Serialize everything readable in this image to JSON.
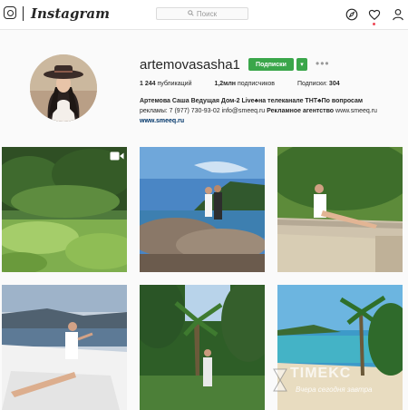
{
  "header": {
    "wordmark": "Instagram",
    "search_placeholder": "Поиск"
  },
  "colors": {
    "follow_green": "#3aa64a",
    "link_blue": "#003569",
    "notification_red": "#ed4956"
  },
  "icons": [
    "instagram-icon",
    "search-icon",
    "compass-icon",
    "heart-icon",
    "person-icon",
    "more-icon",
    "video-icon"
  ],
  "profile": {
    "username": "artemovasasha1",
    "follow_label": "Подписки",
    "dropdown_label": "▾",
    "more_label": "•••",
    "stats": {
      "posts_count": "1 244",
      "posts_label": "публикаций",
      "followers_count": "1,2млн",
      "followers_label": "подписчиков",
      "following_label": "Подписки:",
      "following_count": "304"
    },
    "bio": {
      "line1_bold": "Артемова Саша Ведущая Дом-2 Live♣на телеканале ТНТ♣По вопросам",
      "line2": "рекламы: 7 (977) 730-93-02 info@smeeq.ru",
      "line2_bold": "Рекламное агентство",
      "line2_link": "www.smeeq.ru",
      "website": "www.smeeq.ru"
    }
  },
  "watermark": {
    "title": "TIMEKC",
    "subtitle": "Вчера сегодня завтра"
  }
}
